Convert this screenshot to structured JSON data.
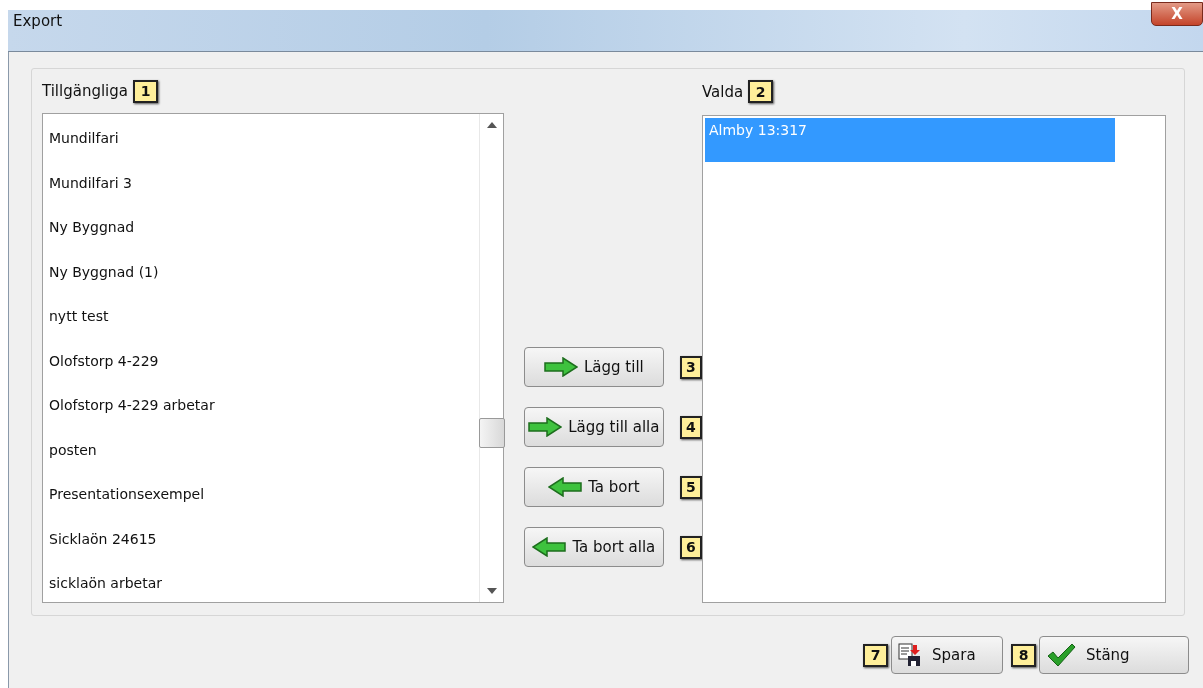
{
  "window": {
    "title": "Export",
    "close": "X"
  },
  "available": {
    "label": "Tillgängliga",
    "badge": "1",
    "items": [
      {
        "text": "Mundilfari",
        "selected": false
      },
      {
        "text": "Mundilfari 3",
        "selected": false
      },
      {
        "text": "Ny Byggnad",
        "selected": false
      },
      {
        "text": "Ny Byggnad (1)",
        "selected": false
      },
      {
        "text": "nytt test",
        "selected": false
      },
      {
        "text": "Olofstorp 4-229",
        "selected": false
      },
      {
        "text": "Olofstorp 4-229 arbetar",
        "selected": false
      },
      {
        "text": "posten",
        "selected": false
      },
      {
        "text": "Presentationsexempel",
        "selected": false
      },
      {
        "text": "Sicklaön 24615",
        "selected": false
      },
      {
        "text": "sicklaön arbetar",
        "selected": false
      }
    ]
  },
  "chosen": {
    "label": "Valda",
    "badge": "2",
    "items": [
      {
        "text": "Almby 13:317",
        "selected": true
      }
    ]
  },
  "move_buttons": [
    {
      "label": "Lägg till",
      "badge": "3",
      "kind": "add"
    },
    {
      "label": "Lägg till alla",
      "badge": "4",
      "kind": "add"
    },
    {
      "label": "Ta bort",
      "badge": "5",
      "kind": "remove"
    },
    {
      "label": "Ta bort alla",
      "badge": "6",
      "kind": "remove"
    }
  ],
  "footer_buttons": [
    {
      "label": "Spara",
      "badge": "7",
      "kind": "save"
    },
    {
      "label": "Stäng",
      "badge": "8",
      "kind": "close"
    }
  ]
}
